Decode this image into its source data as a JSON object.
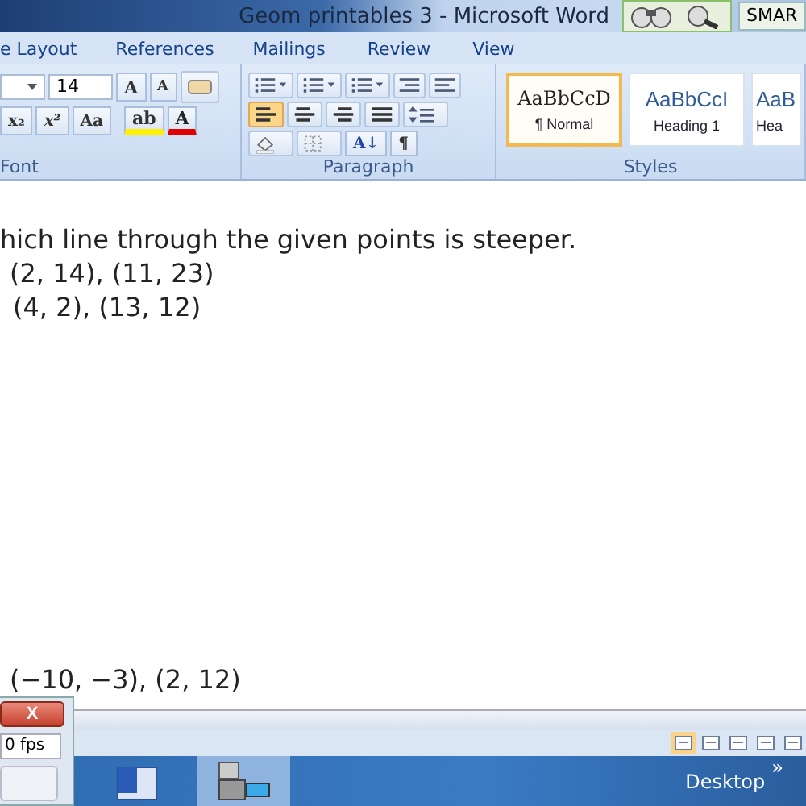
{
  "window": {
    "title": "Geom printables 3 - Microsoft Word",
    "smart_label": "SMAR"
  },
  "tabs": [
    "e Layout",
    "References",
    "Mailings",
    "Review",
    "View"
  ],
  "ribbon": {
    "font": {
      "size": "14",
      "tools_top": [
        {
          "kind": "grow",
          "label": "A"
        },
        {
          "kind": "shrink",
          "label": "A"
        }
      ],
      "tools_bottom": [
        {
          "kind": "sub",
          "label": "x₂"
        },
        {
          "kind": "sup",
          "label": "x²"
        },
        {
          "kind": "case",
          "label": "Aa"
        }
      ],
      "highlight_label": "ab",
      "color_label": "A",
      "group_label": "Font"
    },
    "paragraph": {
      "alignments": [
        {
          "kind": "left",
          "selected": true
        },
        {
          "kind": "center",
          "selected": false
        },
        {
          "kind": "right",
          "selected": false
        },
        {
          "kind": "justify",
          "selected": false
        }
      ],
      "sort_label": "A↓",
      "marks_label": "¶",
      "group_label": "Paragraph"
    },
    "styles": {
      "items": [
        {
          "preview": "AaBbCcD",
          "name": "¶ Normal",
          "selected": true
        },
        {
          "preview": "AaBbCcI",
          "name": "Heading 1",
          "selected": false
        },
        {
          "preview": "AaB",
          "name": "Hea",
          "selected": false
        }
      ],
      "group_label": "Styles"
    }
  },
  "document": {
    "lines": [
      "hich line through the given points is steeper.",
      "(2, 14), (11, 23)",
      "(4, 2), (13, 12)"
    ],
    "bottom_line": "(−10, −3), (2, 12)"
  },
  "recorder": {
    "close_label": "X",
    "fps": "0 fps"
  },
  "taskbar": {
    "desktop": "Desktop",
    "chevron": "»"
  }
}
